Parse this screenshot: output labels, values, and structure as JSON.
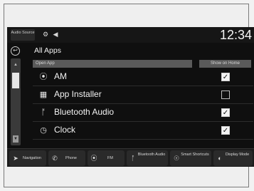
{
  "status": {
    "audio_source": "Audio Source",
    "clock": "12:34"
  },
  "header": {
    "title": "All Apps"
  },
  "columns": {
    "left": "Open App",
    "right": "Show on Home"
  },
  "apps": [
    {
      "label": "AM",
      "icon": "am-radio-icon",
      "checked": true
    },
    {
      "label": "App Installer",
      "icon": "app-installer-icon",
      "checked": false
    },
    {
      "label": "Bluetooth Audio",
      "icon": "bluetooth-icon",
      "checked": true
    },
    {
      "label": "Clock",
      "icon": "clock-icon",
      "checked": true
    }
  ],
  "bottom_nav": [
    {
      "label": "Navigation",
      "icon": "navigation-icon"
    },
    {
      "label": "Phone",
      "icon": "phone-icon"
    },
    {
      "label": "FM",
      "icon": "fm-radio-icon"
    },
    {
      "label": "Bluetooth Audio",
      "icon": "bluetooth-icon"
    },
    {
      "label": "Smart Shortcuts",
      "icon": "smart-shortcuts-icon"
    },
    {
      "label": "Display Mode",
      "icon": "display-mode-icon"
    }
  ],
  "colors": {
    "screen_bg": "#0f0f0f",
    "header_bar": "#5a5a5a",
    "text": "#f2f2f2"
  }
}
